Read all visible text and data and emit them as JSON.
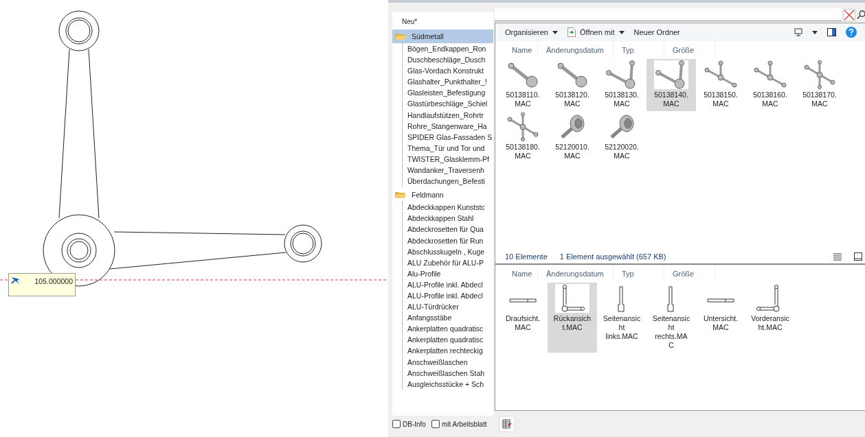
{
  "cad": {
    "dimension_value": "105.000000"
  },
  "tree": {
    "header": "Neu*",
    "groups": [
      {
        "label": "Südmetall",
        "selected": true,
        "children": [
          "Bögen_Endkappen_Ron",
          "Duschbeschläge_Dusch",
          "Glas-Vordach Konstrukt",
          "Glashalter_Punkthalter_!",
          "Glasleisten_Befestigung",
          "Glastürbeschläge_Schiel",
          "Handlaufstützen_Rohrtr",
          "Rohre_Stangenware_Ha",
          "SPIDER Glas-Fassaden S",
          "Thema_Tür und Tor und",
          "TWISTER_Glasklemm-Pf",
          "Wandanker_Traversenh",
          "Überdachungen_Befesti"
        ]
      },
      {
        "label": "Feldmann",
        "selected": false,
        "children": [
          "Abdeckkappen Kunststc",
          "Abdeckkappen Stahl",
          "Abdeckrosetten für Qua",
          "Abdeckrosetten für Run",
          "Abschlusskugeln , Kuge",
          "ALU Zubehör für ALU-P",
          "Alu-Profile",
          "ALU-Profile inkl. Abdecl",
          "ALU-Profile inkl. Abdecl",
          "ALU-Türdrücker",
          "Anfangsstäbe",
          "Ankerplatten quadratisc",
          "Ankerplatten quadratisc",
          "Ankerplatten rechteckig",
          "Anschweißlaschen",
          "Anschweißlaschen Stah",
          "Ausgleichsstücke + Sch"
        ]
      }
    ]
  },
  "options": [
    {
      "label": "DB-Info",
      "checked": false
    },
    {
      "label": "mit Arbeitsblatt",
      "checked": false
    }
  ],
  "toolbar": {
    "organize": "Organisieren",
    "open_with": "Öffnen mit",
    "new_folder": "Neuer Ordner"
  },
  "columns": [
    "Name",
    "Änderungsdatum",
    "Typ",
    "Größe"
  ],
  "columns_lower": [
    "Name",
    "Änderungsdatum",
    "Typ",
    "Größe"
  ],
  "files": [
    {
      "kind": "arm",
      "lines": [
        "50138110.",
        "MAC"
      ],
      "selected": false
    },
    {
      "kind": "arm",
      "lines": [
        "50138120.",
        "MAC"
      ],
      "selected": false
    },
    {
      "kind": "corner",
      "lines": [
        "50138130.",
        "MAC"
      ],
      "selected": false
    },
    {
      "kind": "corner",
      "lines": [
        "50138140.",
        "MAC"
      ],
      "selected": true
    },
    {
      "kind": "tee",
      "lines": [
        "50138150.",
        "MAC"
      ],
      "selected": false
    },
    {
      "kind": "tee",
      "lines": [
        "50138160.",
        "MAC"
      ],
      "selected": false
    },
    {
      "kind": "cross",
      "lines": [
        "50138170.",
        "MAC"
      ],
      "selected": false
    },
    {
      "kind": "cross",
      "lines": [
        "50138180.",
        "MAC"
      ],
      "selected": false
    },
    {
      "kind": "screw",
      "lines": [
        "52120010.",
        "MAC"
      ],
      "selected": false
    },
    {
      "kind": "screw",
      "lines": [
        "52120020.",
        "MAC"
      ],
      "selected": false
    }
  ],
  "status": {
    "count": "10 Elemente",
    "selection": "1 Element ausgewählt (657 KB)"
  },
  "views": [
    {
      "kind": "flat",
      "lines": [
        "Draufsicht.",
        "MAC"
      ],
      "selected": false
    },
    {
      "kind": "back",
      "lines": [
        "Rückansich",
        "t.MAC"
      ],
      "selected": true
    },
    {
      "kind": "side",
      "lines": [
        "Seitenansic",
        "ht",
        "links.MAC"
      ],
      "selected": false
    },
    {
      "kind": "side",
      "lines": [
        "Seitenansic",
        "ht",
        "rechts.MA",
        "C"
      ],
      "selected": false
    },
    {
      "kind": "flat",
      "lines": [
        "Untersicht.",
        "MAC"
      ],
      "selected": false
    },
    {
      "kind": "front",
      "lines": [
        "Vorderansic",
        "ht.MAC"
      ],
      "selected": false
    }
  ]
}
